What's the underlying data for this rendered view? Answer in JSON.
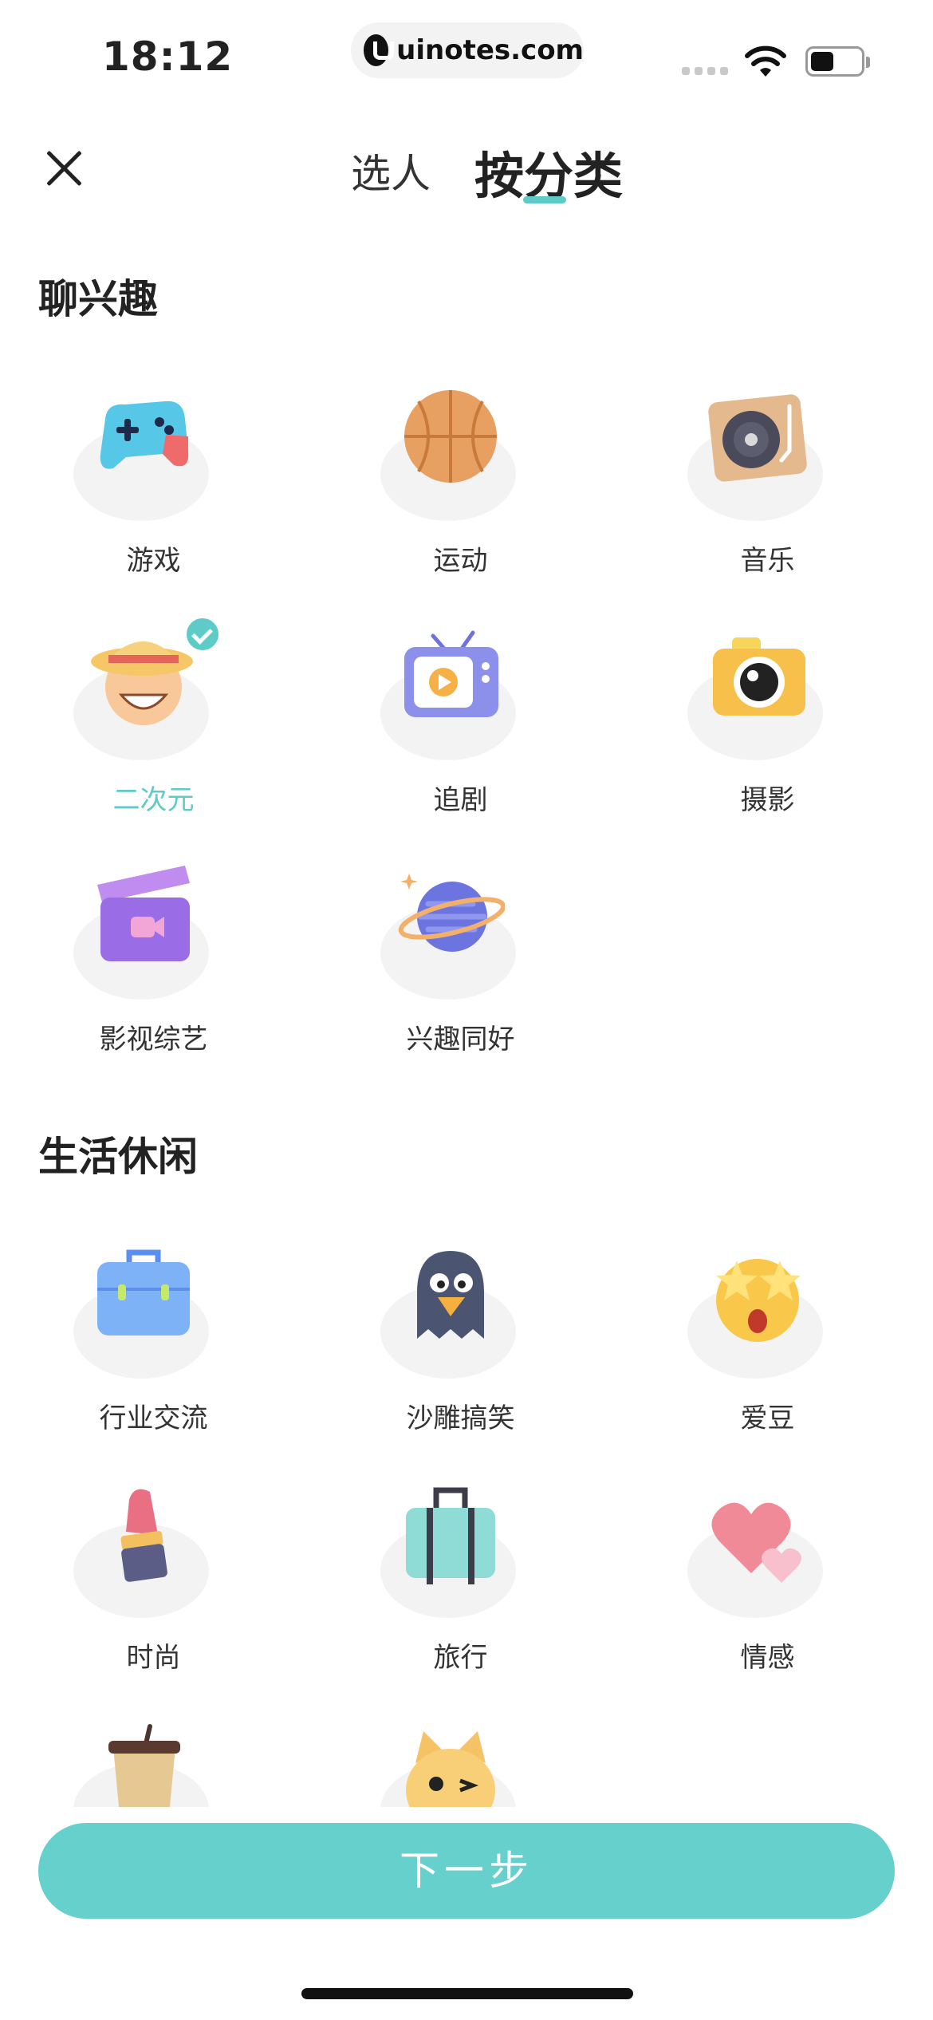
{
  "status_bar": {
    "time": "18:12",
    "url": "uinotes.com"
  },
  "header": {
    "tabs": [
      {
        "label": "选人",
        "active": false
      },
      {
        "label": "按分类",
        "active": true
      }
    ],
    "accent_color": "#5ecbc8"
  },
  "sections": [
    {
      "title": "聊兴趣",
      "items": [
        {
          "label": "游戏",
          "icon": "gamepad-icon",
          "selected": false
        },
        {
          "label": "运动",
          "icon": "basketball-icon",
          "selected": false
        },
        {
          "label": "音乐",
          "icon": "record-player-icon",
          "selected": false
        },
        {
          "label": "二次元",
          "icon": "anime-face-icon",
          "selected": true
        },
        {
          "label": "追剧",
          "icon": "tv-icon",
          "selected": false
        },
        {
          "label": "摄影",
          "icon": "camera-icon",
          "selected": false
        },
        {
          "label": "影视综艺",
          "icon": "clapperboard-icon",
          "selected": false
        },
        {
          "label": "兴趣同好",
          "icon": "planet-icon",
          "selected": false
        }
      ]
    },
    {
      "title": "生活休闲",
      "items": [
        {
          "label": "行业交流",
          "icon": "briefcase-icon",
          "selected": false
        },
        {
          "label": "沙雕搞笑",
          "icon": "ghost-bird-icon",
          "selected": false
        },
        {
          "label": "爱豆",
          "icon": "star-eyes-icon",
          "selected": false
        },
        {
          "label": "时尚",
          "icon": "lipstick-icon",
          "selected": false
        },
        {
          "label": "旅行",
          "icon": "suitcase-icon",
          "selected": false
        },
        {
          "label": "情感",
          "icon": "hearts-icon",
          "selected": false
        },
        {
          "label": "",
          "icon": "coffee-cup-icon",
          "selected": false
        },
        {
          "label": "",
          "icon": "cat-icon",
          "selected": false
        }
      ]
    }
  ],
  "next_button": {
    "label": "下一步",
    "color": "#66d0cc"
  }
}
